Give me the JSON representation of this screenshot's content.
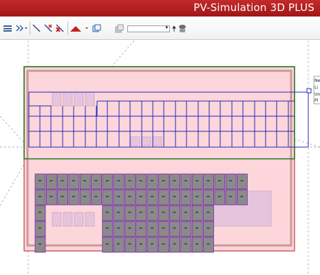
{
  "app": {
    "title": "PV-Simulation 3D PLUS"
  },
  "toolbar": {
    "layer_dropdown": {
      "value": ""
    },
    "icons": [
      "align-grid-icon",
      "distribute-icon",
      "line-tool-icon",
      "remove-line-icon",
      "delete-line-icon",
      "roof-shape-icon",
      "copy-object-icon",
      "layers-icon",
      "camera-eye-icon"
    ]
  },
  "canvas": {
    "side_labels": [
      "Ne",
      "Li",
      "Un",
      "Pl"
    ],
    "lower_array": {
      "modules_top_row": 19,
      "rows": 5
    },
    "colors": {
      "roof_fill": "#fcd6da",
      "roof_border": "#c84848",
      "upper_frame": "#1f7a1f",
      "string_line": "#1f24b8",
      "module_fill": "#8a8a8a",
      "module_border": "#7b23b0",
      "obstacle_fill": "#e6c4dc"
    }
  }
}
